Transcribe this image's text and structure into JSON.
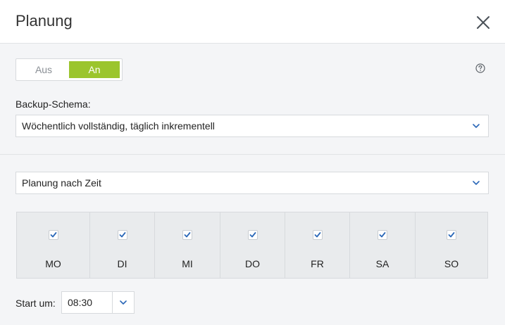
{
  "header": {
    "title": "Planung"
  },
  "toggle": {
    "off_label": "Aus",
    "on_label": "An",
    "value": "An"
  },
  "backup_schema": {
    "label": "Backup-Schema:",
    "value": "Wöchentlich vollständig, täglich inkrementell"
  },
  "schedule_type": {
    "value": "Planung nach Zeit"
  },
  "days": [
    {
      "label": "MO",
      "checked": true
    },
    {
      "label": "DI",
      "checked": true
    },
    {
      "label": "MI",
      "checked": true
    },
    {
      "label": "DO",
      "checked": true
    },
    {
      "label": "FR",
      "checked": true
    },
    {
      "label": "SA",
      "checked": true
    },
    {
      "label": "SO",
      "checked": true
    }
  ],
  "start": {
    "label": "Start um:",
    "time": "08:30"
  },
  "colors": {
    "accent": "#9bc52d",
    "check": "#2b68b8"
  }
}
